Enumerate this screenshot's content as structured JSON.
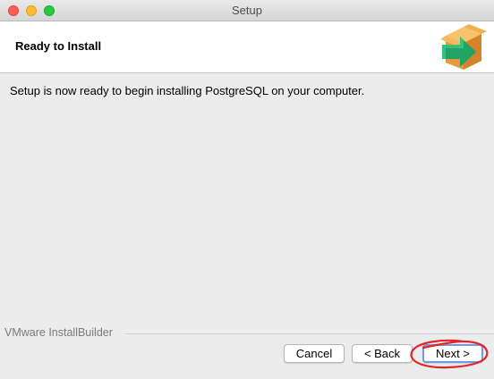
{
  "window": {
    "title": "Setup",
    "buttons": [
      "close",
      "minimize",
      "maximize"
    ]
  },
  "header": {
    "title": "Ready to Install",
    "icon": "box-with-green-arrow-icon"
  },
  "main": {
    "message": "Setup is now ready to begin installing PostgreSQL on your computer."
  },
  "footer": {
    "brand": "VMware InstallBuilder",
    "buttons": {
      "cancel": "Cancel",
      "back": "< Back",
      "next": "Next >"
    }
  },
  "annotation": {
    "type": "hand-drawn circle",
    "color": "#e0262b",
    "target": "next-button"
  },
  "colors": {
    "focus_ring": "#6f9be6",
    "header_bg": "#ffffff",
    "window_bg": "#ececec"
  }
}
